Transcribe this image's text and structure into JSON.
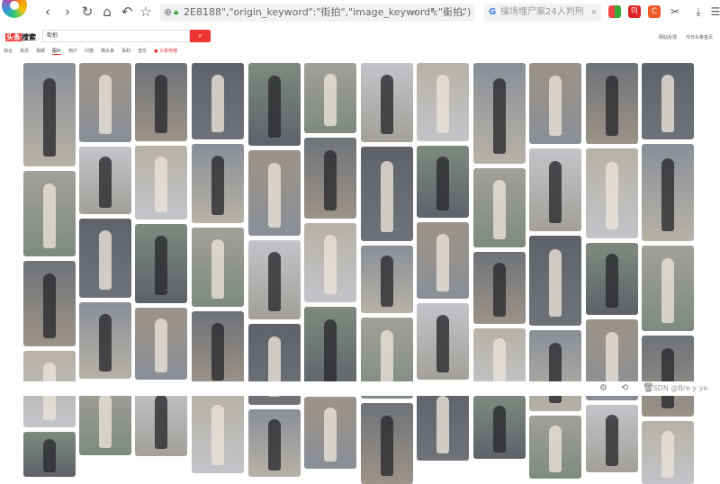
{
  "browser": {
    "url": "2E8188\",\"origin_keyword\":\"街拍\",\"image_keyword\":\"街拍\")",
    "search_placeholder": "操场埋尸案24人判刑",
    "nav": {
      "back": "‹",
      "forward": "›",
      "reload": "↻",
      "home": "⌂",
      "undo": "↶",
      "star": "☆"
    }
  },
  "page": {
    "brand_tag": "头条",
    "brand_text": "搜索",
    "search_value": "街拍",
    "search_icon": "search-icon",
    "tabs": [
      "综合",
      "资讯",
      "视频",
      "图片",
      "用户",
      "问答",
      "微头条",
      "百科",
      "音乐"
    ],
    "active_tab": "图片",
    "hot_link": "头条热榜",
    "top_links": [
      "网站反馈",
      "今日头条首页"
    ]
  },
  "status": {
    "watermark": "CSDN @Bre y ye"
  },
  "colors": {
    "accent": "#e8373a"
  }
}
